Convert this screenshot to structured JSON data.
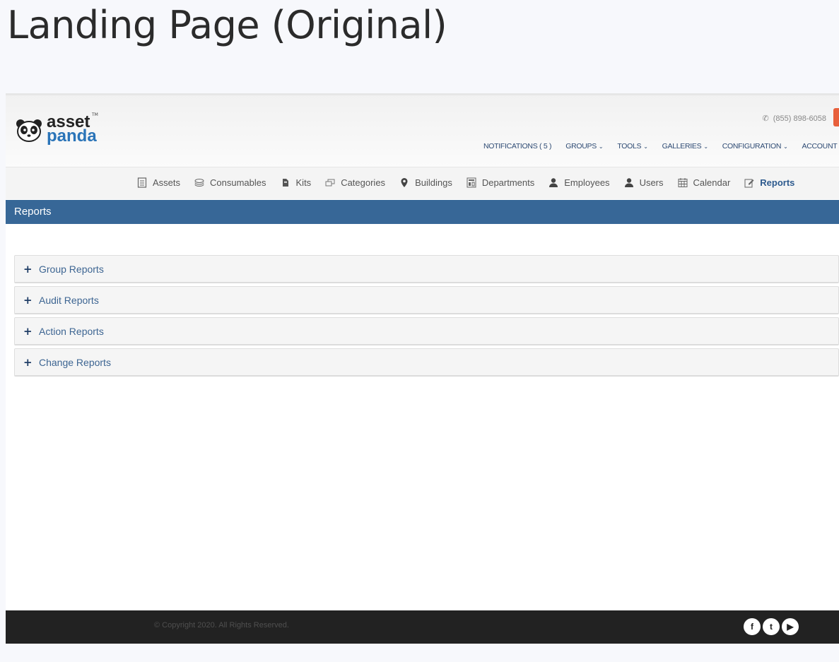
{
  "page": {
    "heading": "Landing Page (Original)"
  },
  "logo": {
    "line1": "asset",
    "line2": "panda",
    "tm": "TM"
  },
  "header": {
    "phone": "(855) 898-6058",
    "nav": [
      {
        "label": "NOTIFICATIONS ( 5 )",
        "dropdown": false
      },
      {
        "label": "GROUPS",
        "dropdown": true
      },
      {
        "label": "TOOLS",
        "dropdown": true
      },
      {
        "label": "GALLERIES",
        "dropdown": true
      },
      {
        "label": "CONFIGURATION",
        "dropdown": true
      },
      {
        "label": "ACCOUNT",
        "dropdown": true
      }
    ]
  },
  "subnav": {
    "items": [
      {
        "label": "Assets",
        "icon": "document-icon"
      },
      {
        "label": "Consumables",
        "icon": "stack-icon"
      },
      {
        "label": "Kits",
        "icon": "kit-icon"
      },
      {
        "label": "Categories",
        "icon": "folders-icon"
      },
      {
        "label": "Buildings",
        "icon": "map-pin-icon"
      },
      {
        "label": "Departments",
        "icon": "department-icon"
      },
      {
        "label": "Employees",
        "icon": "person-icon"
      },
      {
        "label": "Users",
        "icon": "person-icon"
      },
      {
        "label": "Calendar",
        "icon": "calendar-icon"
      },
      {
        "label": "Reports",
        "icon": "edit-icon",
        "active": true
      }
    ]
  },
  "section": {
    "title": "Reports"
  },
  "reports": {
    "groups": [
      {
        "label": "Group Reports"
      },
      {
        "label": "Audit Reports"
      },
      {
        "label": "Action Reports"
      },
      {
        "label": "Change Reports"
      }
    ]
  },
  "footer": {
    "copyright": "© Copyright 2020. All Rights Reserved.",
    "social": [
      {
        "name": "facebook-icon",
        "glyph": "f"
      },
      {
        "name": "twitter-icon",
        "glyph": "t"
      },
      {
        "name": "youtube-icon",
        "glyph": "▶"
      }
    ]
  },
  "colors": {
    "primary": "#376797",
    "accent": "#e8603c",
    "footer": "#222222",
    "link": "#3d6592"
  }
}
